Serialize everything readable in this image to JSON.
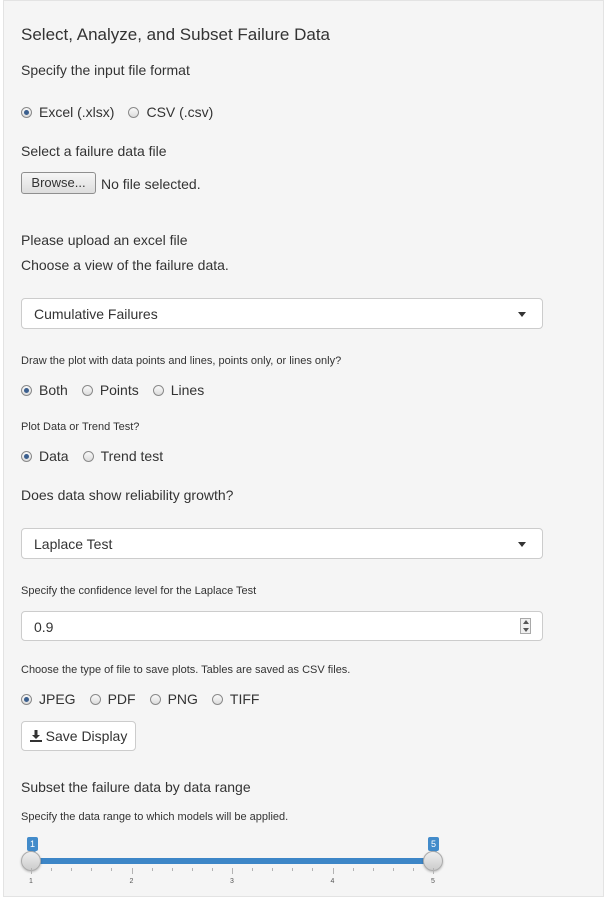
{
  "title": "Select, Analyze, and Subset Failure Data",
  "input_format": {
    "label": "Specify the input file format",
    "options": [
      "Excel (.xlsx)",
      "CSV (.csv)"
    ],
    "selected": "Excel (.xlsx)"
  },
  "file_select": {
    "label": "Select a failure data file",
    "button": "Browse...",
    "status": "No file selected."
  },
  "upload_message": "Please upload an excel file",
  "view": {
    "label": "Choose a view of the failure data.",
    "selected": "Cumulative Failures"
  },
  "plot_style": {
    "label": "Draw the plot with data points and lines, points only, or lines only?",
    "options": [
      "Both",
      "Points",
      "Lines"
    ],
    "selected": "Both"
  },
  "plot_type": {
    "label": "Plot Data or Trend Test?",
    "options": [
      "Data",
      "Trend test"
    ],
    "selected": "Data"
  },
  "growth": {
    "label": "Does data show reliability growth?",
    "selected": "Laplace Test"
  },
  "confidence": {
    "label": "Specify the confidence level for the Laplace Test",
    "value": "0.9"
  },
  "save_type": {
    "label": "Choose the type of file to save plots. Tables are saved as CSV files.",
    "options": [
      "JPEG",
      "PDF",
      "PNG",
      "TIFF"
    ],
    "selected": "JPEG"
  },
  "save_button": "Save Display",
  "subset": {
    "heading": "Subset the failure data by data range",
    "label": "Specify the data range to which models will be applied.",
    "min": 1,
    "max": 5,
    "range_from": "1",
    "range_to": "5",
    "tick_labels": [
      "1",
      "2",
      "3",
      "4",
      "5"
    ]
  },
  "colors": {
    "accent": "#428bca",
    "panel": "#f5f5f5"
  },
  "icons": {
    "save": "download-icon",
    "select": "chevron-down-icon"
  }
}
